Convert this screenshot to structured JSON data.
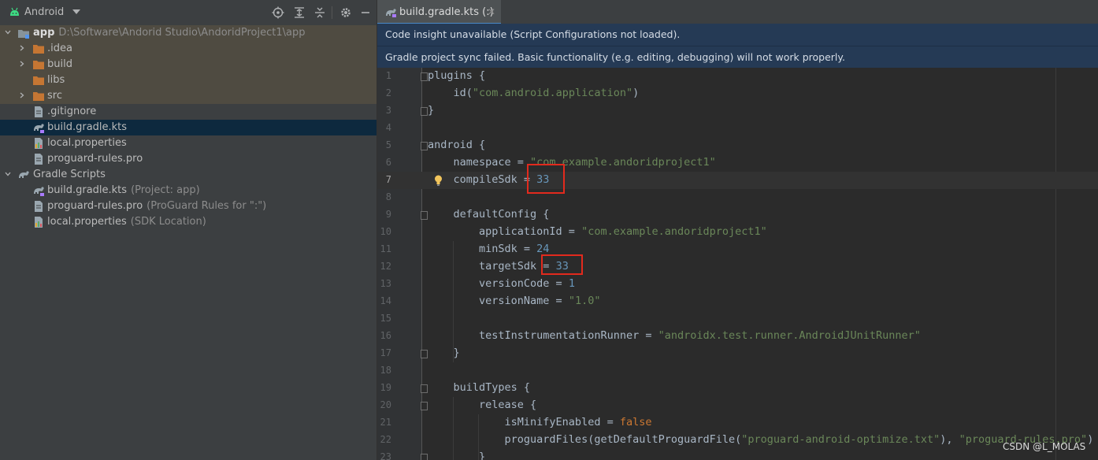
{
  "project_panel": {
    "view_label": "Android",
    "tree": [
      {
        "name": "app",
        "path": "D:\\Software\\Andorid Studio\\AndoridProject1\\app"
      },
      {
        "name": ".idea"
      },
      {
        "name": "build"
      },
      {
        "name": "libs"
      },
      {
        "name": "src"
      },
      {
        "name": ".gitignore"
      },
      {
        "name": "build.gradle.kts"
      },
      {
        "name": "local.properties"
      },
      {
        "name": "proguard-rules.pro"
      },
      {
        "name": "Gradle Scripts"
      },
      {
        "name": "build.gradle.kts",
        "hint": "(Project: app)"
      },
      {
        "name": "proguard-rules.pro",
        "hint": "(ProGuard Rules for \":\")"
      },
      {
        "name": "local.properties",
        "hint": "(SDK Location)"
      }
    ]
  },
  "editor_tab": {
    "label": "build.gradle.kts (:)",
    "close": "✕"
  },
  "banners": {
    "script_config": "Code insight unavailable (Script Configurations not loaded).",
    "sync_failed": "Gradle project sync failed. Basic functionality (e.g. editing, debugging) will not work properly."
  },
  "code_lines": [
    {
      "n": "1",
      "tokens": [
        {
          "t": "plugins {",
          "c": "p"
        }
      ]
    },
    {
      "n": "2",
      "tokens": [
        {
          "t": "    id(",
          "c": "p"
        },
        {
          "t": "\"com.android.application\"",
          "c": "s"
        },
        {
          "t": ")",
          "c": "p"
        }
      ]
    },
    {
      "n": "3",
      "tokens": [
        {
          "t": "}",
          "c": "p"
        }
      ]
    },
    {
      "n": "4",
      "tokens": []
    },
    {
      "n": "5",
      "tokens": [
        {
          "t": "android {",
          "c": "p"
        }
      ]
    },
    {
      "n": "6",
      "tokens": [
        {
          "t": "    namespace = ",
          "c": "p"
        },
        {
          "t": "\"com.example.andoridproject1\"",
          "c": "s"
        }
      ]
    },
    {
      "n": "7",
      "tokens": [
        {
          "t": "    compileSdk = ",
          "c": "p"
        },
        {
          "t": "33",
          "c": "n"
        }
      ]
    },
    {
      "n": "8",
      "tokens": []
    },
    {
      "n": "9",
      "tokens": [
        {
          "t": "    defaultConfig {",
          "c": "p"
        }
      ]
    },
    {
      "n": "10",
      "tokens": [
        {
          "t": "        applicationId = ",
          "c": "p"
        },
        {
          "t": "\"com.example.andoridproject1\"",
          "c": "s"
        }
      ]
    },
    {
      "n": "11",
      "tokens": [
        {
          "t": "        minSdk = ",
          "c": "p"
        },
        {
          "t": "24",
          "c": "n"
        }
      ]
    },
    {
      "n": "12",
      "tokens": [
        {
          "t": "        targetSdk = ",
          "c": "p"
        },
        {
          "t": "33",
          "c": "n"
        }
      ]
    },
    {
      "n": "13",
      "tokens": [
        {
          "t": "        versionCode = ",
          "c": "p"
        },
        {
          "t": "1",
          "c": "n"
        }
      ]
    },
    {
      "n": "14",
      "tokens": [
        {
          "t": "        versionName = ",
          "c": "p"
        },
        {
          "t": "\"1.0\"",
          "c": "s"
        }
      ]
    },
    {
      "n": "15",
      "tokens": []
    },
    {
      "n": "16",
      "tokens": [
        {
          "t": "        testInstrumentationRunner = ",
          "c": "p"
        },
        {
          "t": "\"androidx.test.runner.AndroidJUnitRunner\"",
          "c": "s"
        }
      ]
    },
    {
      "n": "17",
      "tokens": [
        {
          "t": "    }",
          "c": "p"
        }
      ]
    },
    {
      "n": "18",
      "tokens": []
    },
    {
      "n": "19",
      "tokens": [
        {
          "t": "    buildTypes {",
          "c": "p"
        }
      ]
    },
    {
      "n": "20",
      "tokens": [
        {
          "t": "        release {",
          "c": "p"
        }
      ]
    },
    {
      "n": "21",
      "tokens": [
        {
          "t": "            isMinifyEnabled = ",
          "c": "p"
        },
        {
          "t": "false",
          "c": "k"
        }
      ]
    },
    {
      "n": "22",
      "tokens": [
        {
          "t": "            proguardFiles(getDefaultProguardFile(",
          "c": "p"
        },
        {
          "t": "\"proguard-android-optimize.txt\"",
          "c": "s"
        },
        {
          "t": "), ",
          "c": "p"
        },
        {
          "t": "\"proguard-rules.pro\"",
          "c": "s"
        },
        {
          "t": ")",
          "c": "p"
        }
      ]
    },
    {
      "n": "23",
      "tokens": [
        {
          "t": "        }",
          "c": "p"
        }
      ]
    }
  ],
  "watermark": "CSDN @L_MOLAS",
  "colors": {
    "accent": "#4a88c7",
    "annotation": "#e22a1d",
    "folder": "#c57633",
    "selection": "#0d293e"
  },
  "icons": [
    "android-icon",
    "locate-icon",
    "expand-all-icon",
    "collapse-all-icon",
    "gear-icon",
    "minimize-icon",
    "folder-icon",
    "gradle-icon",
    "file-icon",
    "properties-icon",
    "bulb-icon"
  ]
}
